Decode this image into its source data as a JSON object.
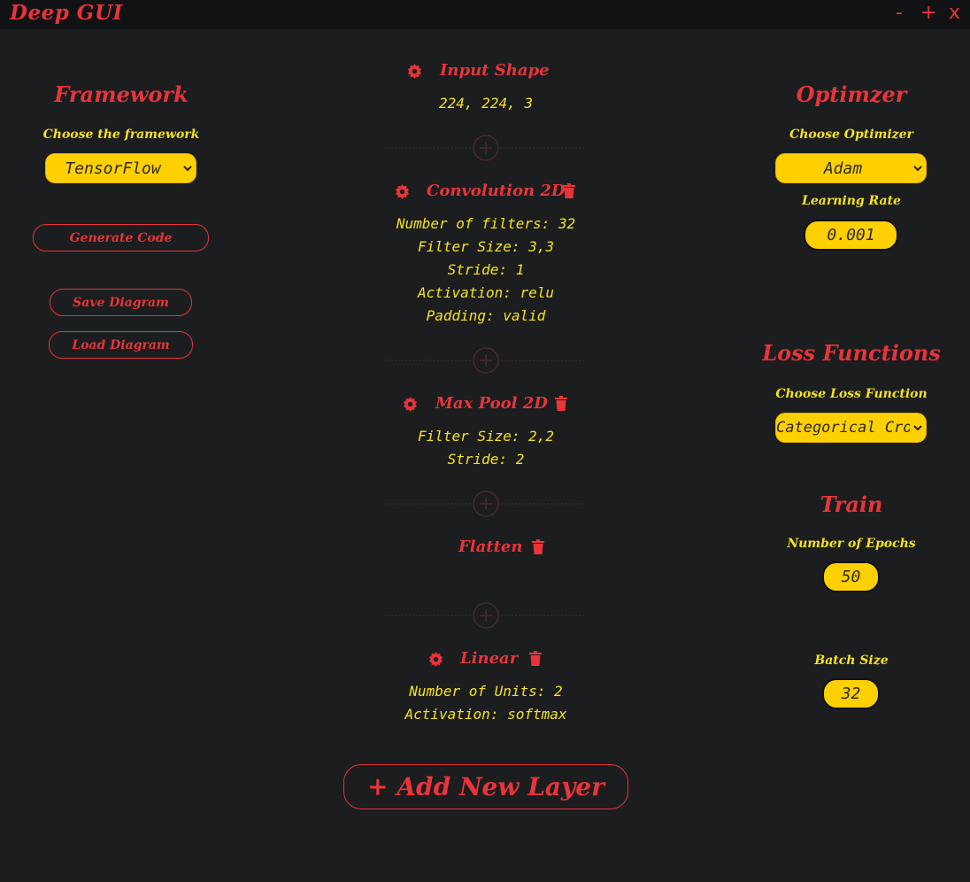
{
  "app": {
    "title": "Deep GUI",
    "controls": {
      "minimize": "-",
      "maximize": "+",
      "close": "x"
    }
  },
  "left": {
    "framework_heading": "Framework",
    "framework_label": "Choose the framework",
    "framework_value": "TensorFlow",
    "generate_code": "Generate Code",
    "save_diagram": "Save Diagram",
    "load_diagram": "Load Diagram"
  },
  "center": {
    "layers": [
      {
        "title": "Input Shape",
        "params": [
          "224, 224, 3"
        ]
      },
      {
        "title": "Convolution 2D",
        "params": [
          "Number of filters: 32",
          "Filter Size: 3,3",
          "Stride: 1",
          "Activation: relu",
          "Padding: valid"
        ]
      },
      {
        "title": "Max Pool 2D",
        "params": [
          "Filter Size: 2,2",
          "Stride: 2"
        ]
      },
      {
        "title": "Flatten",
        "params": []
      },
      {
        "title": "Linear",
        "params": [
          "Number of Units: 2",
          "Activation: softmax"
        ]
      }
    ],
    "add_layer": "+ Add New Layer"
  },
  "right": {
    "optimizer_heading": "Optimzer",
    "optimizer_label": "Choose Optimizer",
    "optimizer_value": "Adam",
    "learning_rate_label": "Learning Rate",
    "learning_rate_value": "0.001",
    "loss_heading": "Loss Functions",
    "loss_label": "Choose Loss Function",
    "loss_value": "Categorical Cross",
    "train_heading": "Train",
    "epochs_label": "Number of Epochs",
    "epochs_value": "50",
    "batch_label": "Batch Size",
    "batch_value": "32"
  },
  "colors": {
    "background": "#1b1d1f",
    "titlebar": "#111214",
    "accent_red": "#e8343a",
    "label_yellow": "#f6e21f",
    "input_yellow": "#ffd000"
  },
  "icons": [
    "gear-icon",
    "trash-icon",
    "plus-circle-icon",
    "chevron-down-icon"
  ]
}
